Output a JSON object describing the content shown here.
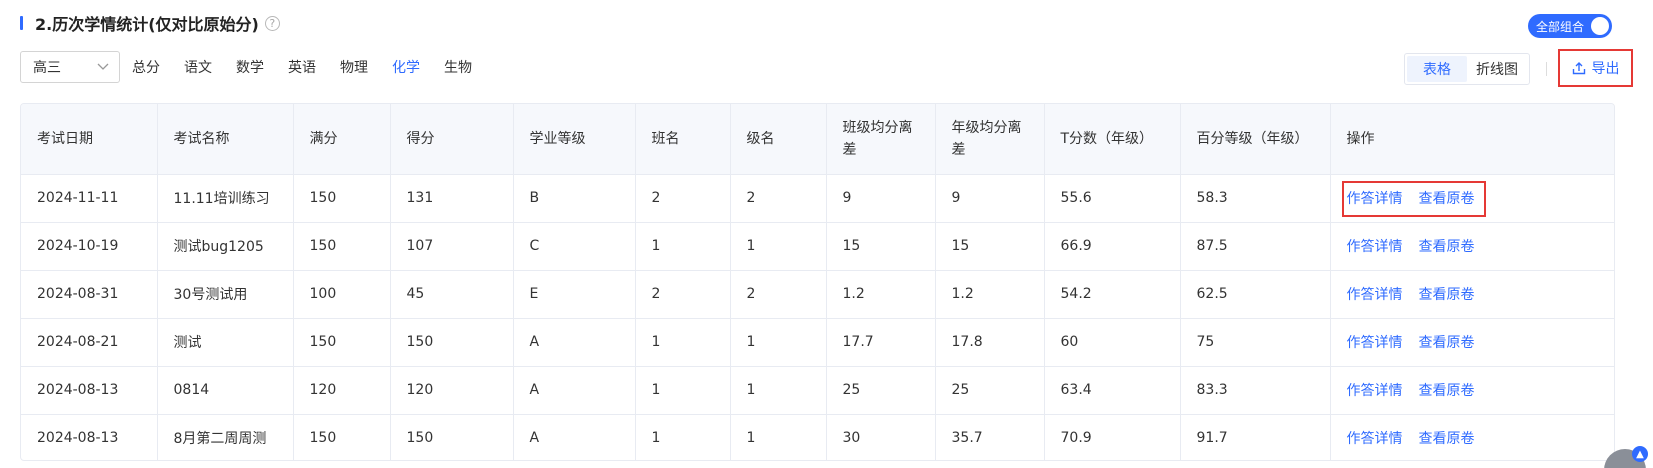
{
  "section": {
    "title": "2.历次学情统计(仅对比原始分)",
    "help_glyph": "?"
  },
  "toggle": {
    "label": "全部组合",
    "on": true
  },
  "grade_select": {
    "value": "高三"
  },
  "subjects": [
    {
      "label": "总分",
      "active": false
    },
    {
      "label": "语文",
      "active": false
    },
    {
      "label": "数学",
      "active": false
    },
    {
      "label": "英语",
      "active": false
    },
    {
      "label": "物理",
      "active": false
    },
    {
      "label": "化学",
      "active": true
    },
    {
      "label": "生物",
      "active": false
    }
  ],
  "view_toggle": {
    "table": "表格",
    "line": "折线图",
    "selected": "表格"
  },
  "export": {
    "label": "导出"
  },
  "table": {
    "headers": [
      "考试日期",
      "考试名称",
      "满分",
      "得分",
      "学业等级",
      "班名",
      "级名",
      "班级均分离差",
      "年级均分离差",
      "T分数（年级）",
      "百分等级（年级）",
      "操作"
    ],
    "header_lines": [
      [
        "考试日期"
      ],
      [
        "考试名称"
      ],
      [
        "满分"
      ],
      [
        "得分"
      ],
      [
        "学业等级"
      ],
      [
        "班名"
      ],
      [
        "级名"
      ],
      [
        "班级均分离",
        "差"
      ],
      [
        "年级均分离",
        "差"
      ],
      [
        "T分数（年级）"
      ],
      [
        "百分等级（年级）"
      ],
      [
        "操作"
      ]
    ],
    "rows": [
      [
        "2024-11-11",
        "11.11培训练习",
        "150",
        "131",
        "B",
        "2",
        "2",
        "9",
        "9",
        "55.6",
        "58.3"
      ],
      [
        "2024-10-19",
        "测试bug1205",
        "150",
        "107",
        "C",
        "1",
        "1",
        "15",
        "15",
        "66.9",
        "87.5"
      ],
      [
        "2024-08-31",
        "30号测试用",
        "100",
        "45",
        "E",
        "2",
        "2",
        "1.2",
        "1.2",
        "54.2",
        "62.5"
      ],
      [
        "2024-08-21",
        "测试",
        "150",
        "150",
        "A",
        "1",
        "1",
        "17.7",
        "17.8",
        "60",
        "75"
      ],
      [
        "2024-08-13",
        "0814",
        "120",
        "120",
        "A",
        "1",
        "1",
        "25",
        "25",
        "63.4",
        "83.3"
      ],
      [
        "2024-08-13",
        "8月第二周周测",
        "150",
        "150",
        "A",
        "1",
        "1",
        "30",
        "35.7",
        "70.9",
        "91.7"
      ]
    ],
    "actions": {
      "detail": "作答详情",
      "original": "查看原卷"
    }
  },
  "colors": {
    "accent": "#2f6bff",
    "highlight": "#e53935"
  },
  "icons": {
    "help": "question-circle-icon",
    "chevron": "chevron-down-icon",
    "export": "upload-icon"
  }
}
